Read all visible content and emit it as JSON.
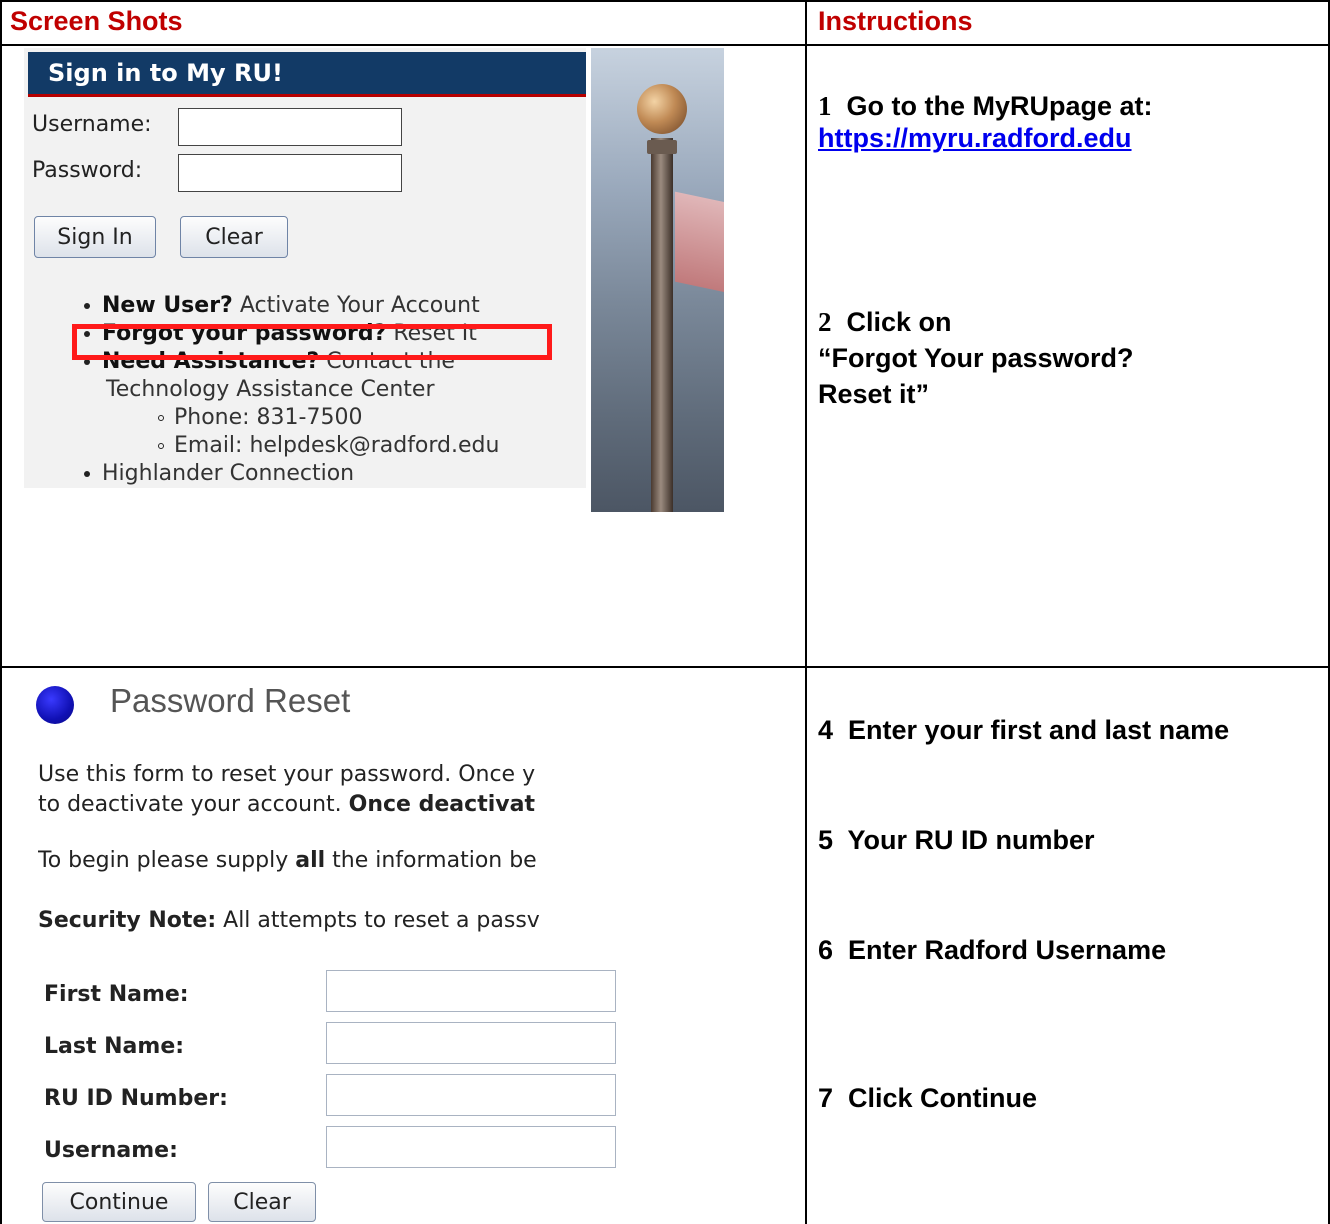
{
  "colors": {
    "header_text": "#c00000",
    "signin_title_bg": "#123a66",
    "highlight_box": "#ff1a1a",
    "link": "#0000ee",
    "reset_dot": "#1010b4"
  },
  "table": {
    "header_left": "Screen Shots",
    "header_right": "Instructions"
  },
  "signin": {
    "title": "Sign in to My RU!",
    "username_label": "Username:",
    "password_label": "Password:",
    "username_value": "",
    "password_value": "",
    "sign_in_button": "Sign In",
    "clear_button": "Clear",
    "links": {
      "new_user_bold": "New User?",
      "new_user_link": "Activate Your Account",
      "forgot_bold": "Forgot your password?",
      "forgot_link": "Reset It",
      "assist_bold": "Need Assistance?",
      "assist_text": "Contact the",
      "assist_line2": "Technology Assistance Center",
      "phone": "Phone: 831-7500",
      "email": "Email: helpdesk@radford.edu",
      "highlander": "Highlander Connection"
    }
  },
  "reset": {
    "title": "Password Reset",
    "para1_line1": "Use this form to reset your password. Once y",
    "para1_line2_text": "to deactivate your account.",
    "para1_line2_bold": "Once deactivat",
    "para2_text": "To begin please supply",
    "para2_bold": "all",
    "para2_rest": "the information be",
    "security_bold": "Security Note:",
    "security_text": "All attempts to reset a passv",
    "fields": {
      "first_name": "First Name:",
      "last_name": "Last Name:",
      "ru_id": "RU ID Number:",
      "username": "Username:"
    },
    "continue_button": "Continue",
    "clear_button": "Clear"
  },
  "instructions": {
    "step1_num": "1",
    "step1_text": "Go to the MyRUpage at:",
    "step1_link": "https://myru.radford.edu",
    "step2_num": "2",
    "step2_text": "Click on",
    "step2_line2": "“Forgot Your password?",
    "step2_line3": "Reset it”",
    "step4": "4  Enter your first and last name",
    "step5": "5  Your RU ID number",
    "step6": "6  Enter Radford Username",
    "step7": "7  Click Continue"
  }
}
